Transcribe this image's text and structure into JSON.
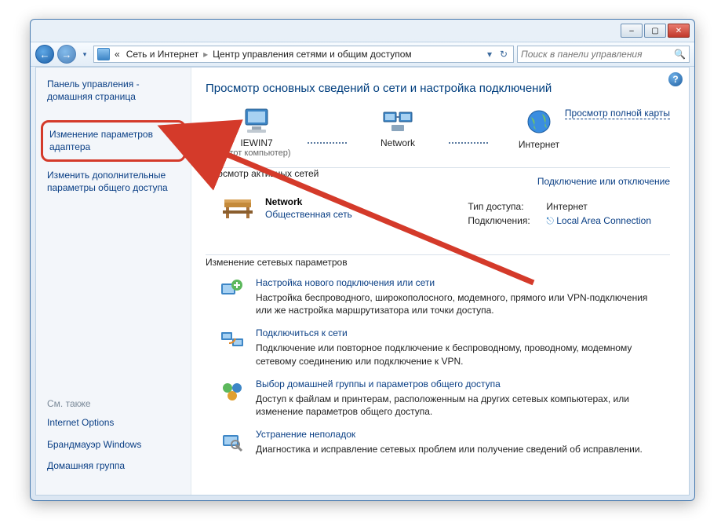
{
  "titlebar": {
    "minimize": "–",
    "maximize": "▢",
    "close": "✕"
  },
  "toolbar": {
    "back": "←",
    "forward": "→",
    "addr_prefix": "«",
    "addr_seg1": "Сеть и Интернет",
    "addr_seg2": "Центр управления сетями и общим доступом",
    "search_placeholder": "Поиск в панели управления"
  },
  "sidebar": {
    "home": "Панель управления - домашняя страница",
    "adapter": "Изменение параметров адаптера",
    "advanced": "Изменить дополнительные параметры общего доступа",
    "also_hdr": "См. также",
    "also_1": "Internet Options",
    "also_2": "Брандмауэр Windows",
    "also_3": "Домашняя группа"
  },
  "main": {
    "title": "Просмотр основных сведений о сети и настройка подключений",
    "map": {
      "pc_name": "IEWIN7",
      "pc_sub": "(этот компьютер)",
      "net_name": "Network",
      "internet": "Интернет",
      "fullmap": "Просмотр полной карты"
    },
    "active_hdr": "Просмотр активных сетей",
    "active_link": "Подключение или отключение",
    "network": {
      "name": "Network",
      "type": "Общественная сеть",
      "access_label": "Тип доступа:",
      "access_val": "Интернет",
      "conn_label": "Подключения:",
      "conn_val": "Local Area Connection"
    },
    "change_hdr": "Изменение сетевых параметров",
    "tasks": [
      {
        "head": "Настройка нового подключения или сети",
        "desc": "Настройка беспроводного, широкополосного, модемного, прямого или VPN-подключения или же настройка маршрутизатора или точки доступа."
      },
      {
        "head": "Подключиться к сети",
        "desc": "Подключение или повторное подключение к беспроводному, проводному, модемному сетевому соединению или подключение к VPN."
      },
      {
        "head": "Выбор домашней группы и параметров общего доступа",
        "desc": "Доступ к файлам и принтерам, расположенным на других сетевых компьютерах, или изменение параметров общего доступа."
      },
      {
        "head": "Устранение неполадок",
        "desc": "Диагностика и исправление сетевых проблем или получение сведений об исправлении."
      }
    ]
  }
}
